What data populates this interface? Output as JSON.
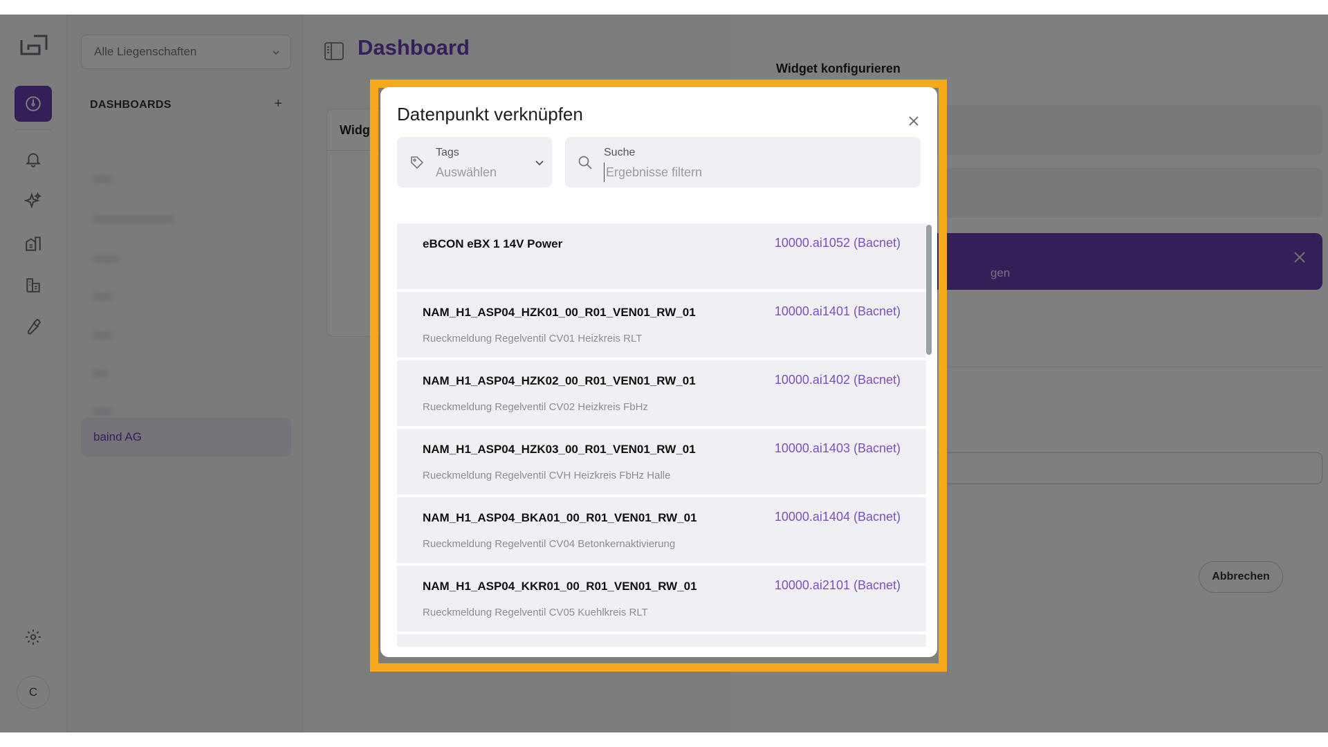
{
  "sidebar": {
    "property_select": "Alle Liegenschaften",
    "section_title": "DASHBOARDS",
    "add_symbol": "+",
    "active_item": "baind AG"
  },
  "main": {
    "title": "Dashboard",
    "widget_header": "Widg"
  },
  "panel": {
    "title": "Widget konfigurieren",
    "banner_text": "gen",
    "cancel_label": "Abbrechen"
  },
  "user": {
    "avatar_initial": "C"
  },
  "modal": {
    "title": "Datenpunkt verknüpfen",
    "tags": {
      "label": "Tags",
      "value": "Auswählen"
    },
    "search": {
      "label": "Suche",
      "placeholder": "Ergebnisse filtern"
    },
    "rows": [
      {
        "name": "eBCON eBX 1 14V Power",
        "address": "10000.ai1052 (Bacnet)",
        "description": ""
      },
      {
        "name": "NAM_H1_ASP04_HZK01_00_R01_VEN01_RW_01",
        "address": "10000.ai1401 (Bacnet)",
        "description": "Rueckmeldung Regelventil CV01 Heizkreis RLT"
      },
      {
        "name": "NAM_H1_ASP04_HZK02_00_R01_VEN01_RW_01",
        "address": "10000.ai1402 (Bacnet)",
        "description": "Rueckmeldung Regelventil CV02 Heizkreis FbHz"
      },
      {
        "name": "NAM_H1_ASP04_HZK03_00_R01_VEN01_RW_01",
        "address": "10000.ai1403 (Bacnet)",
        "description": "Rueckmeldung Regelventil CVH Heizkreis FbHz Halle"
      },
      {
        "name": "NAM_H1_ASP04_BKA01_00_R01_VEN01_RW_01",
        "address": "10000.ai1404 (Bacnet)",
        "description": "Rueckmeldung Regelventil CV04 Betonkernaktivierung"
      },
      {
        "name": "NAM_H1_ASP04_KKR01_00_R01_VEN01_RW_01",
        "address": "10000.ai2101 (Bacnet)",
        "description": "Rueckmeldung Regelventil CV05 Kuehlkreis RLT"
      }
    ]
  },
  "colors": {
    "accent": "#6b3fb3",
    "highlight": "#f7a91c",
    "address_text": "#7b4fbf"
  }
}
